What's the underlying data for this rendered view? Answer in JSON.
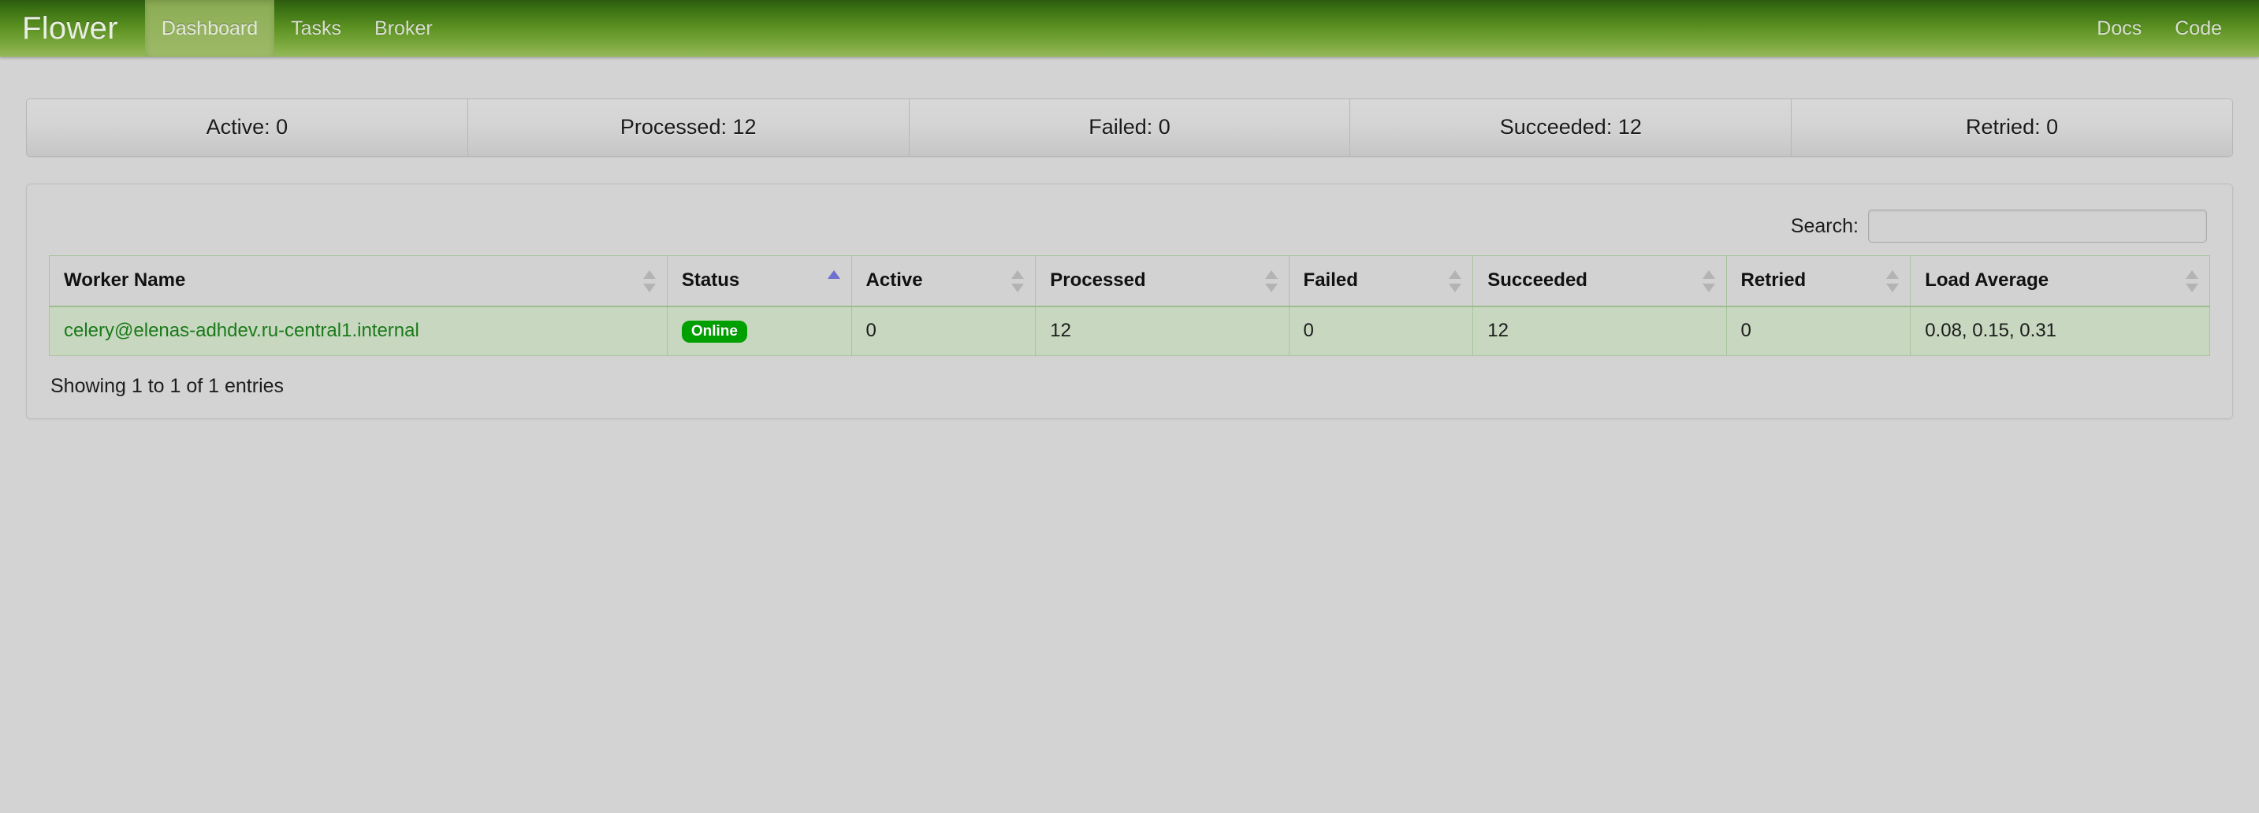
{
  "navbar": {
    "brand": "Flower",
    "links": [
      {
        "label": "Dashboard",
        "active": true
      },
      {
        "label": "Tasks",
        "active": false
      },
      {
        "label": "Broker",
        "active": false
      }
    ],
    "right_links": [
      {
        "label": "Docs"
      },
      {
        "label": "Code"
      }
    ],
    "brand_color": "#5b9121"
  },
  "stats": [
    {
      "label": "Active: 0"
    },
    {
      "label": "Processed: 12"
    },
    {
      "label": "Failed: 0"
    },
    {
      "label": "Succeeded: 12"
    },
    {
      "label": "Retried: 0"
    }
  ],
  "search": {
    "label": "Search:",
    "value": "",
    "placeholder": ""
  },
  "table": {
    "columns": [
      {
        "label": "Worker Name",
        "sort": "none"
      },
      {
        "label": "Status",
        "sort": "asc"
      },
      {
        "label": "Active",
        "sort": "none"
      },
      {
        "label": "Processed",
        "sort": "none"
      },
      {
        "label": "Failed",
        "sort": "none"
      },
      {
        "label": "Succeeded",
        "sort": "none"
      },
      {
        "label": "Retried",
        "sort": "none"
      },
      {
        "label": "Load Average",
        "sort": "none"
      }
    ],
    "rows": [
      {
        "worker_name": "celery@elenas-adhdev.ru-central1.internal",
        "status": "Online",
        "active": "0",
        "processed": "12",
        "failed": "0",
        "succeeded": "12",
        "retried": "0",
        "load_average": "0.08, 0.15, 0.31"
      }
    ],
    "info": "Showing 1 to 1 of 1 entries",
    "status_badge_color": "#00a000",
    "row_highlight_color": "#c8d8c0",
    "sort_active_color": "#6f6fd0"
  }
}
